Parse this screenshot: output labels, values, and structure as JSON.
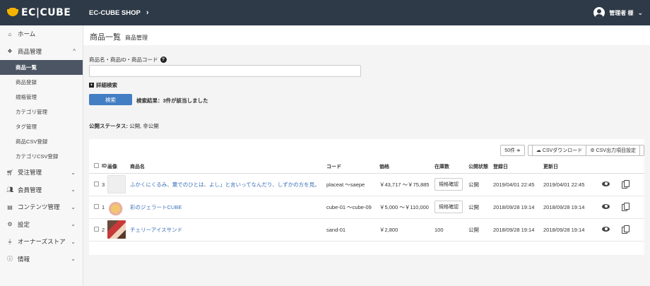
{
  "header": {
    "logo_text": "EC|CUBE",
    "shop_name": "EC-CUBE SHOP",
    "shop_chevron": "›",
    "user_name": "管理者 様",
    "user_caret": "⌄"
  },
  "sidebar": {
    "items": [
      {
        "label": "ホーム",
        "icon": "home-icon",
        "arrow": ""
      },
      {
        "label": "商品管理",
        "icon": "cube-icon",
        "arrow": "^"
      },
      {
        "label": "受注管理",
        "icon": "cart-icon",
        "arrow": "⌄"
      },
      {
        "label": "会員管理",
        "icon": "users-icon",
        "arrow": "⌄"
      },
      {
        "label": "コンテンツ管理",
        "icon": "file-icon",
        "arrow": "⌄"
      },
      {
        "label": "設定",
        "icon": "gear-icon",
        "arrow": "⌄"
      },
      {
        "label": "オーナーズストア",
        "icon": "plug-icon",
        "arrow": "⌄"
      },
      {
        "label": "情報",
        "icon": "info-icon",
        "arrow": "⌄"
      }
    ],
    "product_sub": [
      {
        "label": "商品一覧"
      },
      {
        "label": "商品登録"
      },
      {
        "label": "規格管理"
      },
      {
        "label": "カテゴリ管理"
      },
      {
        "label": "タグ管理"
      },
      {
        "label": "商品CSV登録"
      },
      {
        "label": "カテゴリCSV登録"
      }
    ]
  },
  "page": {
    "title": "商品一覧",
    "subtitle": "商品管理"
  },
  "search": {
    "label": "商品名・商品ID・商品コード",
    "help": "?",
    "value": "",
    "placeholder": "",
    "detail_toggle": "詳細検索",
    "button_label": "検索",
    "result_text": "検索結果：3件が該当しました",
    "status_label": "公開ステータス:",
    "status_value": " 公開, 非公開"
  },
  "toolbar": {
    "per_page": "50件 ≑",
    "csv_download": "CSVダウンロード",
    "csv_settings": "CSV出力項目設定"
  },
  "table": {
    "headers": [
      "ID",
      "画像",
      "商品名",
      "コード",
      "価格",
      "在庫数",
      "公開状態",
      "登録日",
      "更新日"
    ],
    "rows": [
      {
        "id": "3",
        "name": "ふかくにくるみ、葉でのひとは、よし」と言いってなんだり、しずかの方を見。",
        "code": "placeat 〜saepe",
        "price": "￥43,717 〜￥75,885",
        "stock": "規格確認",
        "status": "公開",
        "created": "2019/04/01 22:45",
        "updated": "2019/04/01 22:45"
      },
      {
        "id": "1",
        "name": "彩のジェラートCUBE",
        "code": "cube-01 〜cube-09",
        "price": "￥5,000 〜￥110,000",
        "stock": "規格確認",
        "status": "公開",
        "created": "2018/09/28 19:14",
        "updated": "2018/09/28 19:14"
      },
      {
        "id": "2",
        "name": "チェリーアイスサンド",
        "code": "sand-01",
        "price": "￥2,800",
        "stock": "100",
        "status": "公開",
        "created": "2018/09/28 19:14",
        "updated": "2018/09/28 19:14"
      }
    ]
  }
}
